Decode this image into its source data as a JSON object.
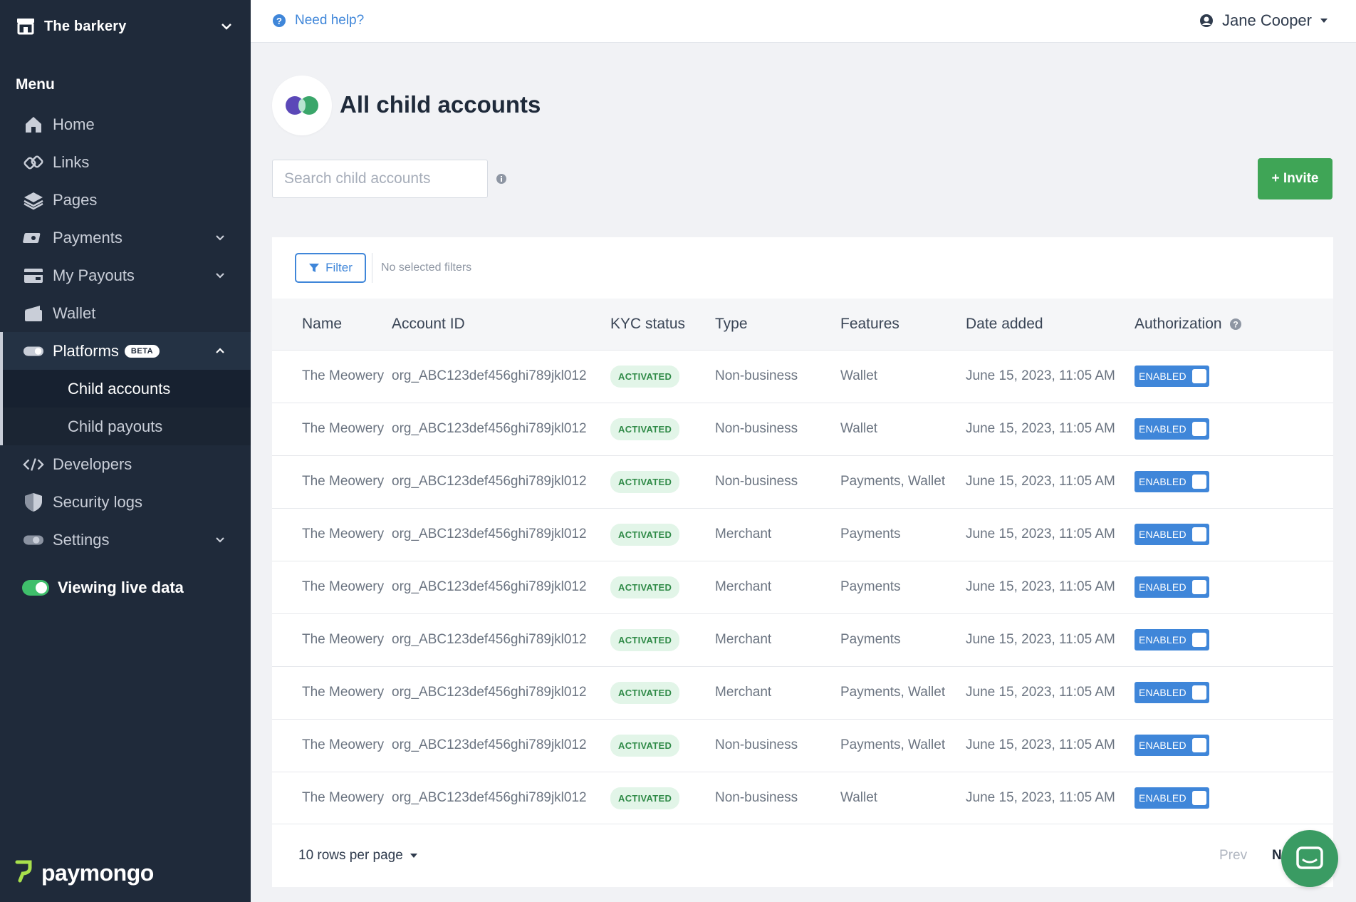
{
  "sidebar": {
    "org_name": "The barkery",
    "menu_heading": "Menu",
    "items": [
      {
        "label": "Home",
        "icon": "home-icon"
      },
      {
        "label": "Links",
        "icon": "links-icon"
      },
      {
        "label": "Pages",
        "icon": "pages-icon"
      },
      {
        "label": "Payments",
        "icon": "payments-icon"
      },
      {
        "label": "My Payouts",
        "icon": "payouts-icon"
      },
      {
        "label": "Wallet",
        "icon": "wallet-icon"
      },
      {
        "label": "Platforms",
        "icon": "platforms-icon",
        "badge": "BETA"
      },
      {
        "label": "Developers",
        "icon": "code-icon"
      },
      {
        "label": "Security logs",
        "icon": "shield-icon"
      },
      {
        "label": "Settings",
        "icon": "settings-toggle-icon"
      }
    ],
    "platforms_sub": [
      {
        "label": "Child accounts"
      },
      {
        "label": "Child payouts"
      }
    ],
    "live_label": "Viewing live data",
    "brand": "paymongo"
  },
  "topbar": {
    "help_label": "Need help?",
    "user_name": "Jane Cooper"
  },
  "page": {
    "title": "All child accounts",
    "search_placeholder": "Search child accounts",
    "invite_label": "+ Invite",
    "filter_label": "Filter",
    "no_filters": "No selected filters"
  },
  "table": {
    "columns": [
      "Name",
      "Account ID",
      "KYC status",
      "Type",
      "Features",
      "Date added",
      "Authorization"
    ],
    "rows": [
      {
        "name": "The Meowery",
        "account_id": "org_ABC123def456ghi789jkl012",
        "kyc": "ACTIVATED",
        "type": "Non-business",
        "features": "Wallet",
        "date": "June 15, 2023, 11:05 AM",
        "auth": "ENABLED"
      },
      {
        "name": "The Meowery",
        "account_id": "org_ABC123def456ghi789jkl012",
        "kyc": "ACTIVATED",
        "type": "Non-business",
        "features": "Wallet",
        "date": "June 15, 2023, 11:05 AM",
        "auth": "ENABLED"
      },
      {
        "name": "The Meowery",
        "account_id": "org_ABC123def456ghi789jkl012",
        "kyc": "ACTIVATED",
        "type": "Non-business",
        "features": "Payments, Wallet",
        "date": "June 15, 2023, 11:05 AM",
        "auth": "ENABLED"
      },
      {
        "name": "The Meowery",
        "account_id": "org_ABC123def456ghi789jkl012",
        "kyc": "ACTIVATED",
        "type": "Merchant",
        "features": "Payments",
        "date": "June 15, 2023, 11:05 AM",
        "auth": "ENABLED"
      },
      {
        "name": "The Meowery",
        "account_id": "org_ABC123def456ghi789jkl012",
        "kyc": "ACTIVATED",
        "type": "Merchant",
        "features": "Payments",
        "date": "June 15, 2023, 11:05 AM",
        "auth": "ENABLED"
      },
      {
        "name": "The Meowery",
        "account_id": "org_ABC123def456ghi789jkl012",
        "kyc": "ACTIVATED",
        "type": "Merchant",
        "features": "Payments",
        "date": "June 15, 2023, 11:05 AM",
        "auth": "ENABLED"
      },
      {
        "name": "The Meowery",
        "account_id": "org_ABC123def456ghi789jkl012",
        "kyc": "ACTIVATED",
        "type": "Merchant",
        "features": "Payments, Wallet",
        "date": "June 15, 2023, 11:05 AM",
        "auth": "ENABLED"
      },
      {
        "name": "The Meowery",
        "account_id": "org_ABC123def456ghi789jkl012",
        "kyc": "ACTIVATED",
        "type": "Non-business",
        "features": "Payments, Wallet",
        "date": "June 15, 2023, 11:05 AM",
        "auth": "ENABLED"
      },
      {
        "name": "The Meowery",
        "account_id": "org_ABC123def456ghi789jkl012",
        "kyc": "ACTIVATED",
        "type": "Non-business",
        "features": "Wallet",
        "date": "June 15, 2023, 11:05 AM",
        "auth": "ENABLED"
      }
    ]
  },
  "pagination": {
    "rows_per_page": "10 rows per page",
    "prev_label": "Prev",
    "next_label": "N"
  },
  "colors": {
    "sidebar_bg": "#1f2a3a",
    "accent_blue": "#3f86d9",
    "invite_green": "#3fa556",
    "kyc_green": "#2f8a47",
    "live_toggle": "#3fbf6b"
  }
}
